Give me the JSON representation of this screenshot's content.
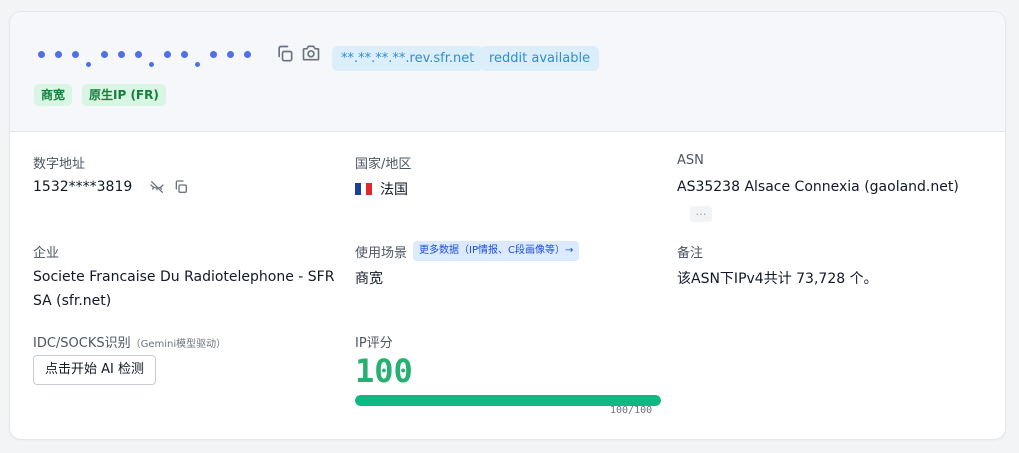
{
  "header": {
    "ip_mask": [
      "•••",
      "•••",
      "••",
      "•••"
    ],
    "hostname": "**.**.**.**.rev.sfr.net",
    "reddit_status": "reddit available",
    "tags": [
      "商宽",
      "原生IP (FR)"
    ]
  },
  "fields": {
    "numeric": {
      "label": "数字地址",
      "value": "1532****3819"
    },
    "country": {
      "label": "国家/地区",
      "value": "法国",
      "flag_colors": [
        "#1f3e99",
        "#ffffff",
        "#e1262d"
      ]
    },
    "asn": {
      "label": "ASN",
      "value": "AS35238 Alsace Connexia (gaoland.net)",
      "more": "…"
    },
    "company": {
      "label": "企业",
      "value": "Societe Francaise Du Radiotelephone - SFR SA (sfr.net)"
    },
    "usage": {
      "label": "使用场景",
      "value": "商宽",
      "more_link": "更多数据（IP情报、C段画像等）→"
    },
    "note": {
      "label": "备注",
      "value": "该ASN下IPv4共计 73,728 个。"
    },
    "idc": {
      "label": "IDC/SOCKS识别",
      "label_note": "（Gemini模型驱动）",
      "button": "点击开始 AI 检测"
    },
    "score": {
      "label": "IP评分",
      "value": "100",
      "max": 100,
      "fraction": 1.0,
      "text": "100/100"
    }
  },
  "colors": {
    "accent": "#4f6fe6",
    "score_green": "#10b981",
    "tag_green": "#15803d"
  }
}
